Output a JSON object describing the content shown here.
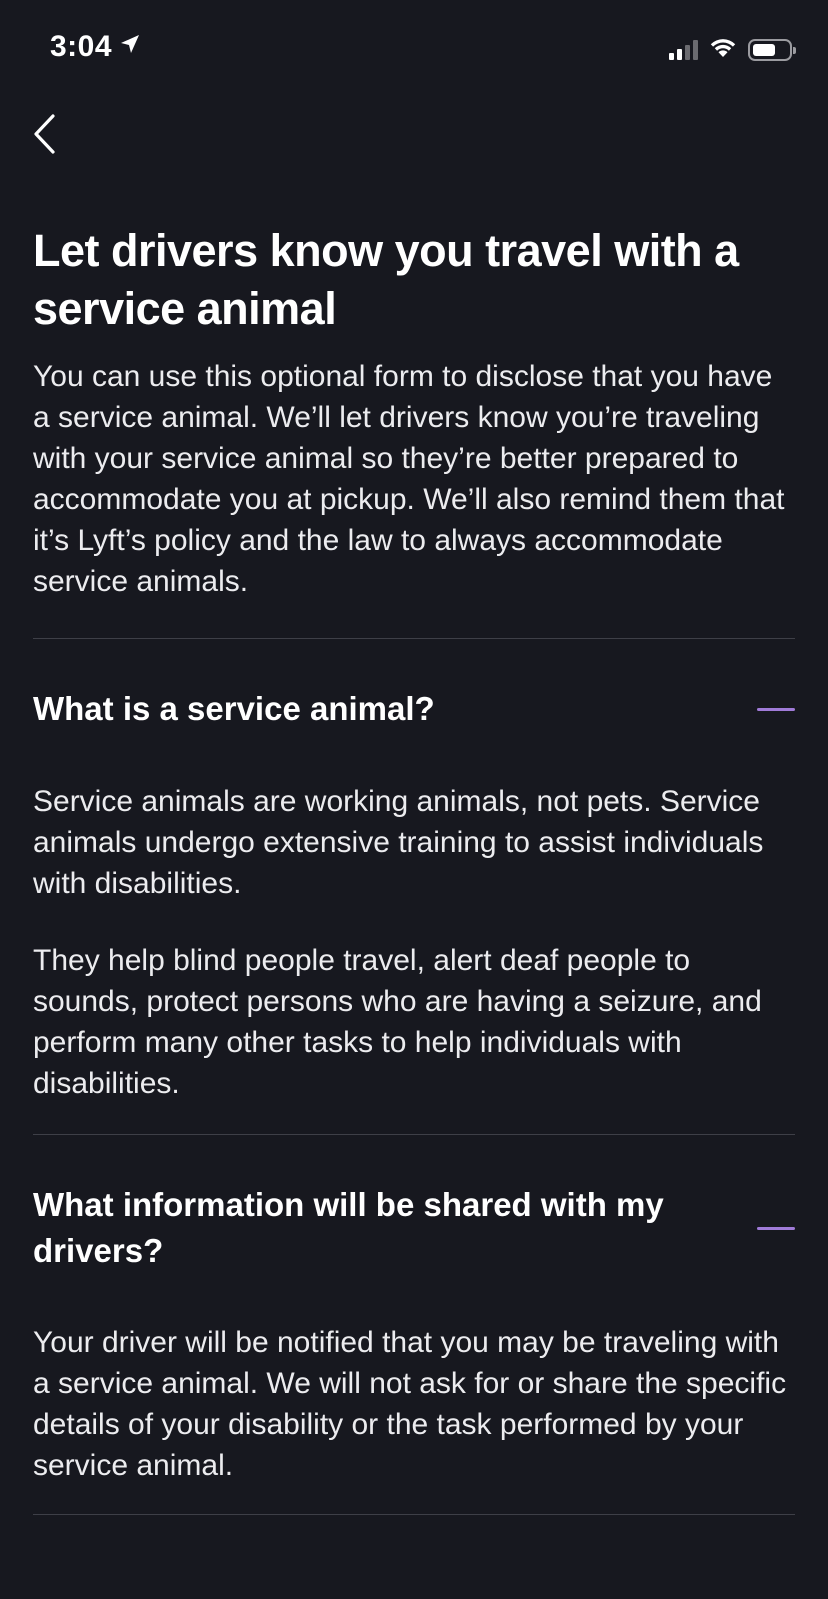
{
  "status_bar": {
    "time": "3:04",
    "location_icon": "location-arrow-icon",
    "signal_icon": "cellular-signal-icon",
    "wifi_icon": "wifi-icon",
    "battery_icon": "battery-icon",
    "battery_level": 0.65
  },
  "nav": {
    "back_icon": "chevron-left-icon"
  },
  "page": {
    "title": "Let drivers know you travel with a service animal",
    "intro": "You can use this optional form to disclose that you have a service animal. We’ll let drivers know you’re traveling with your service animal so they’re better prepared to accommodate you at pickup. We’ll also remind them that it’s Lyft’s policy and the law to always accommodate service animals."
  },
  "faq": [
    {
      "question": "What is a service animal?",
      "expanded": true,
      "toggle_icon": "minus-icon",
      "answers": [
        "Service animals are working animals, not pets. Service animals undergo extensive training to assist individuals with disabilities.",
        "They help blind people travel, alert deaf people to sounds, protect persons who are having a seizure, and perform many other tasks to help individuals with disabilities."
      ]
    },
    {
      "question": "What information will be shared with my drivers?",
      "expanded": true,
      "toggle_icon": "minus-icon",
      "answers": [
        "Your driver will be notified that you may be traveling with a service animal. We will not ask for or share the specific details of your disability or the task performed by your service animal."
      ]
    }
  ],
  "colors": {
    "background": "#17181f",
    "text": "#ffffff",
    "accent": "#a07bd8",
    "divider": "#3e3f47"
  }
}
